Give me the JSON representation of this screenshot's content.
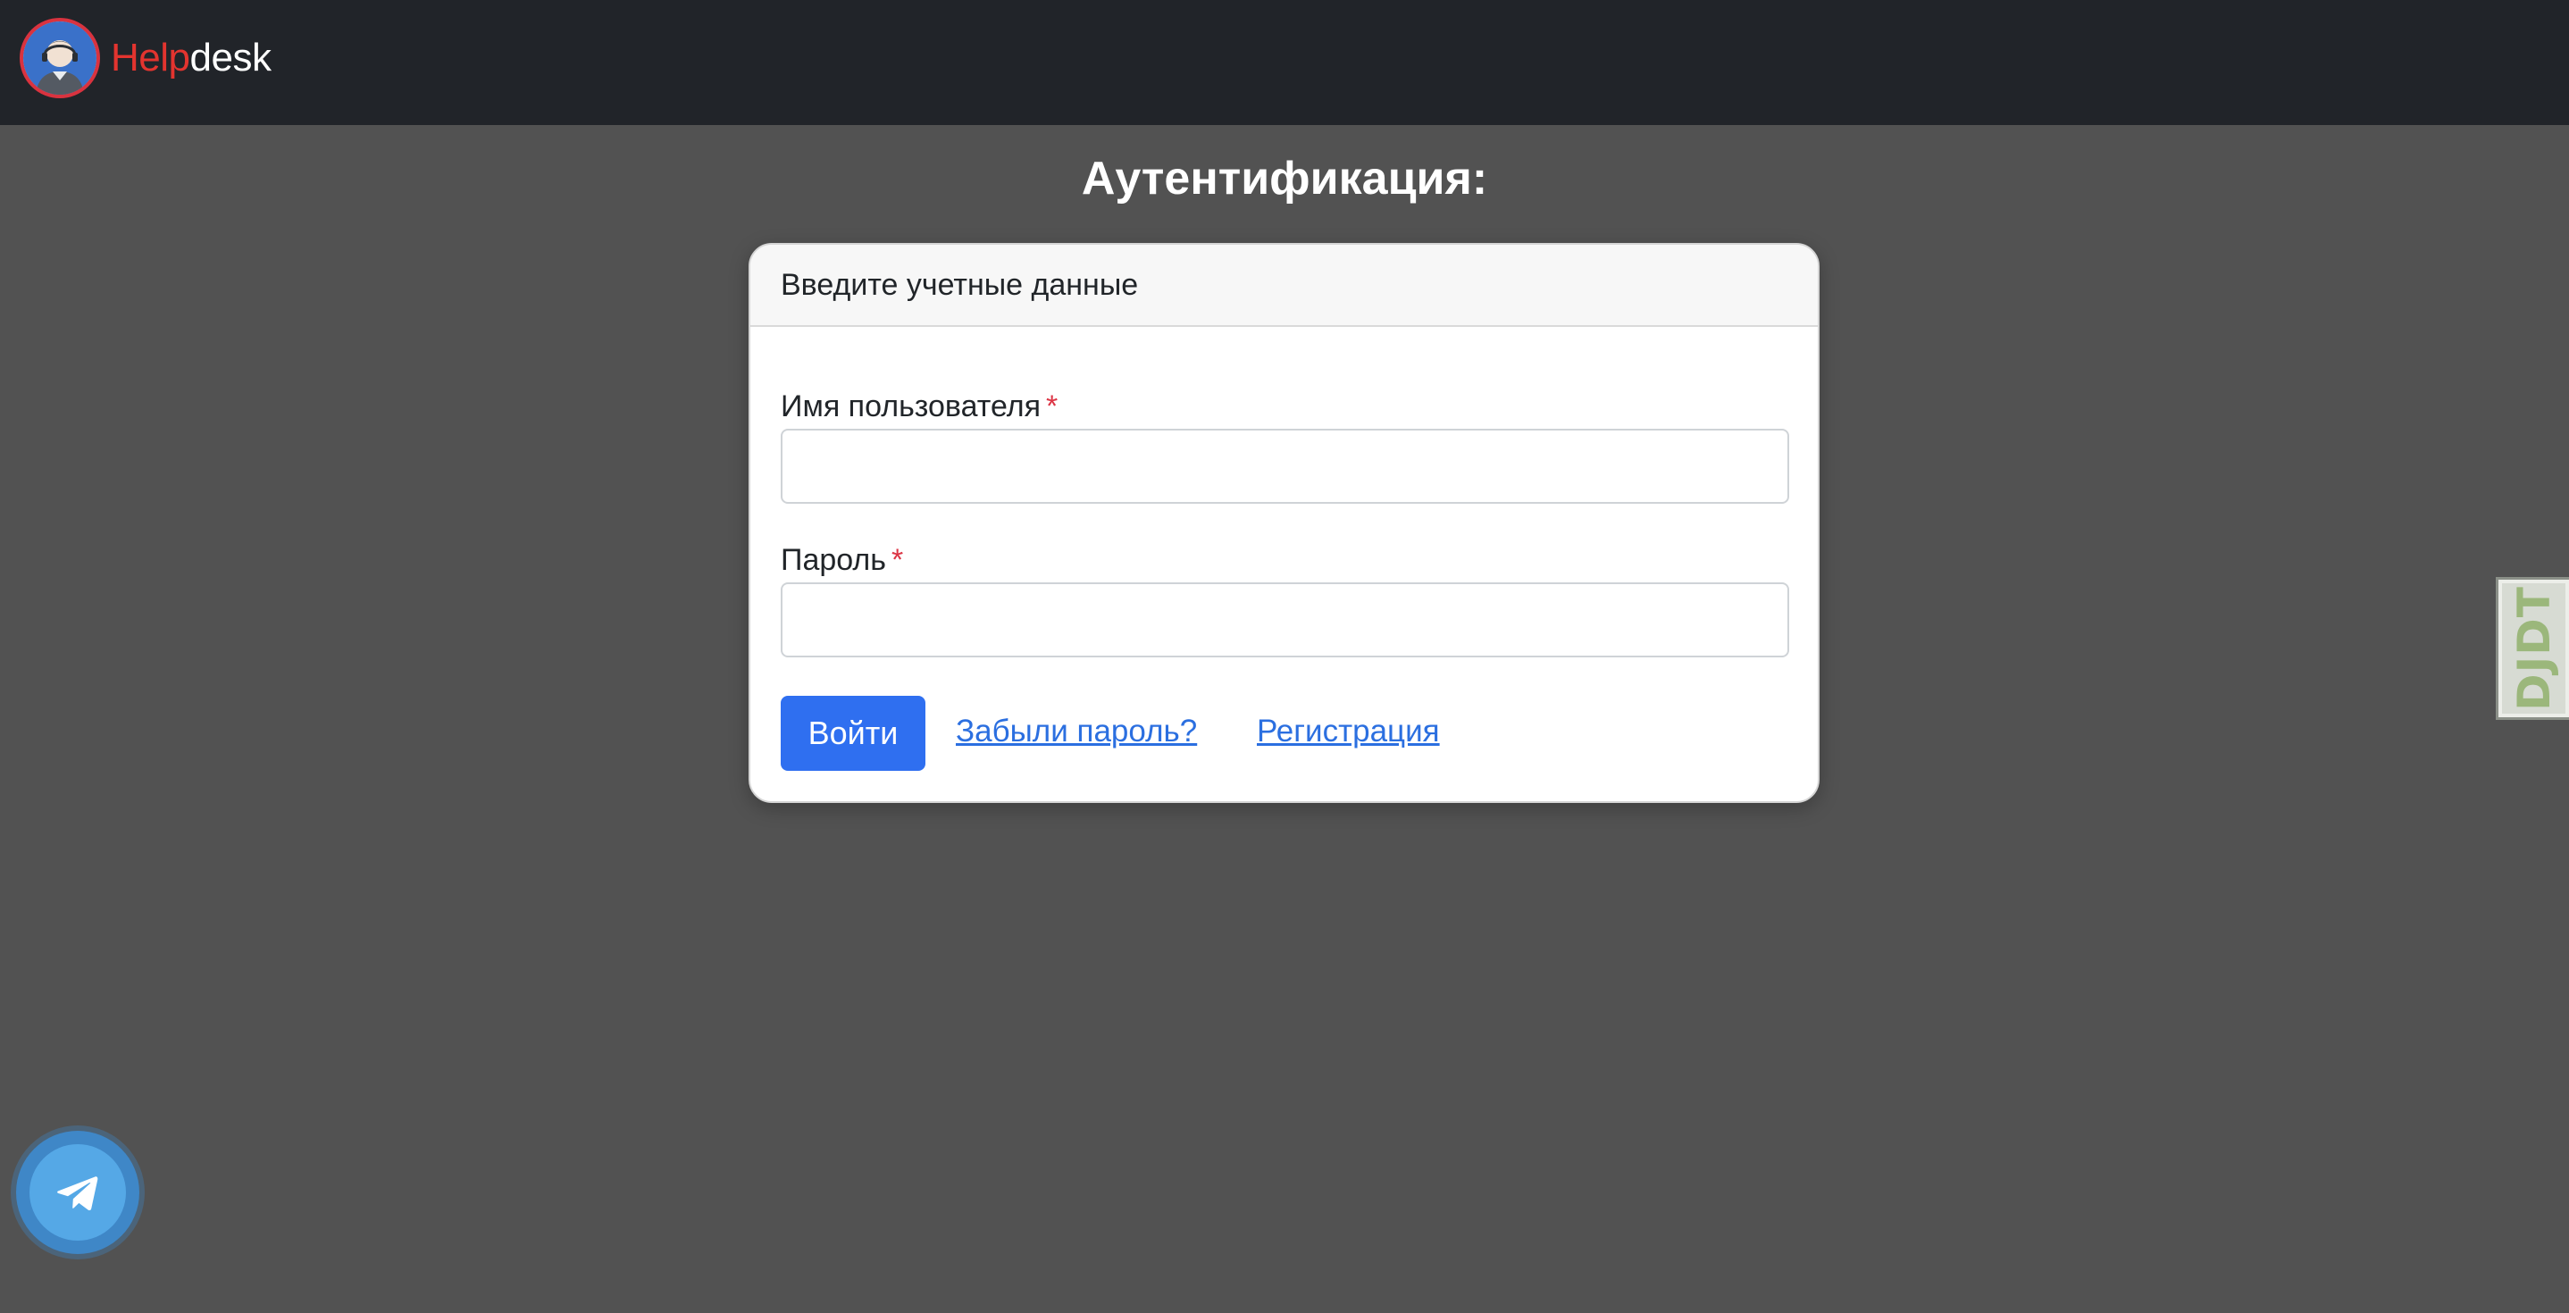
{
  "navbar": {
    "brand_part1": "Help",
    "brand_part2": "desk",
    "logo_icon": "support-agent-avatar"
  },
  "page": {
    "title": "Аутентификация:"
  },
  "login_card": {
    "header": "Введите учетные данные",
    "username_label": "Имя пользователя",
    "username_value": "",
    "password_label": "Пароль",
    "password_value": "",
    "required_marker": "*",
    "submit_label": "Войти",
    "forgot_link": "Забыли пароль?",
    "register_link": "Регистрация"
  },
  "debug_toolbar": {
    "label": "DJDT"
  },
  "telegram_button": {
    "icon": "telegram-plane-icon"
  },
  "colors": {
    "navbar_bg": "#212429",
    "page_bg": "#525252",
    "brand_accent": "#e3342f",
    "primary": "#2f6ff0",
    "link": "#2b6fe0",
    "required": "#dc3545"
  }
}
